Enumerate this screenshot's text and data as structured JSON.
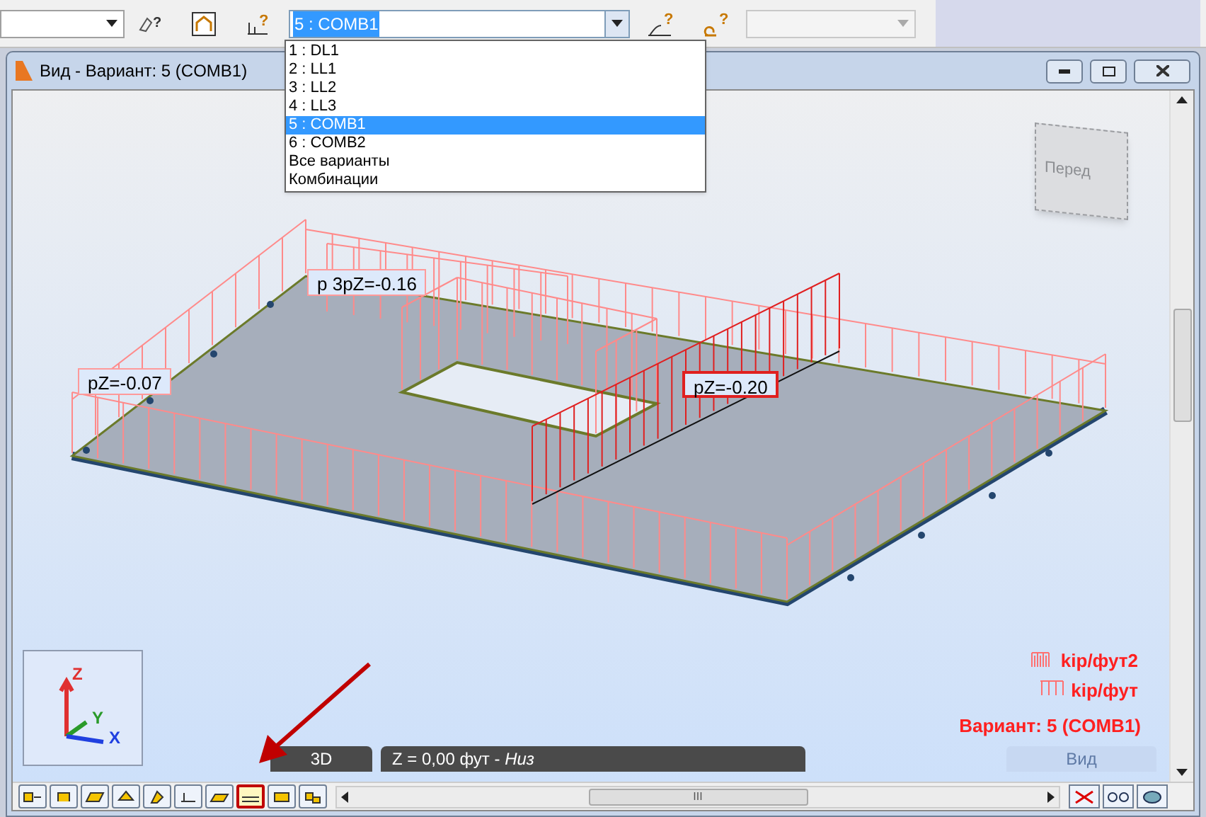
{
  "toolbar": {
    "query_marks": [
      "?",
      "?",
      "?",
      "?"
    ],
    "load_case_combo": {
      "value": "5 : COMB1",
      "expanded": true
    },
    "right_combo": {
      "disabled": true
    }
  },
  "load_case_options": [
    {
      "label": "1 : DL1",
      "selected": false
    },
    {
      "label": "2 : LL1",
      "selected": false
    },
    {
      "label": "3 : LL2",
      "selected": false
    },
    {
      "label": "4 : LL3",
      "selected": false
    },
    {
      "label": "5 : COMB1",
      "selected": true
    },
    {
      "label": "6 : COMB2",
      "selected": false
    },
    {
      "label": "Все варианты",
      "selected": false
    },
    {
      "label": "Комбинации",
      "selected": false
    }
  ],
  "window": {
    "title": "Вид - Вариант: 5 (COMB1)"
  },
  "view_cube": {
    "front_label": "Перед"
  },
  "load_labels": [
    {
      "text": "p 3pZ=-0.16",
      "highlighted": false
    },
    {
      "text": "pZ=-0.07",
      "highlighted": false
    },
    {
      "text": "pZ=-0.20",
      "highlighted": true
    }
  ],
  "axes": {
    "z": "Z",
    "y": "Y",
    "x": "X"
  },
  "legend": [
    {
      "kind": "area",
      "unit": "kip/фут2"
    },
    {
      "kind": "line",
      "unit": "kip/фут"
    }
  ],
  "case_label": "Вариант: 5 (COMB1)",
  "view_bar": {
    "mode": "3D",
    "level": "Z = 0,00 фут - *Низ*",
    "view_button": {
      "label": "Вид",
      "disabled": true
    }
  },
  "bottom_toolbar": [
    {
      "selected": false
    },
    {
      "selected": false
    },
    {
      "selected": false
    },
    {
      "selected": false
    },
    {
      "selected": false
    },
    {
      "selected": false
    },
    {
      "selected": false
    },
    {
      "selected": true
    },
    {
      "selected": false
    },
    {
      "selected": false
    }
  ],
  "scroll_thumb": "III"
}
